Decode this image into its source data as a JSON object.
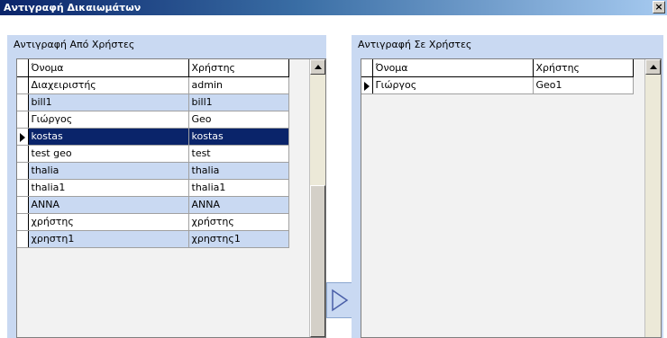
{
  "window": {
    "title": "Αντιγραφή Δικαιωμάτων",
    "close_glyph": "×"
  },
  "left_panel": {
    "header": "Αντιγραφή Από Χρήστες",
    "columns": [
      "Όνομα",
      "Χρήστης"
    ],
    "rows": [
      {
        "name": "Διαχειριστής",
        "user": "admin",
        "style": "white"
      },
      {
        "name": "bill1",
        "user": "bill1",
        "style": "blue"
      },
      {
        "name": "Γιώργος",
        "user": "Geo",
        "style": "white"
      },
      {
        "name": "kostas",
        "user": "kostas",
        "style": "selected"
      },
      {
        "name": "test geo",
        "user": "test",
        "style": "white"
      },
      {
        "name": "thalia",
        "user": "thalia",
        "style": "blue"
      },
      {
        "name": "thalia1",
        "user": "thalia1",
        "style": "white"
      },
      {
        "name": "ANNA",
        "user": "ANNA",
        "style": "blue"
      },
      {
        "name": "χρήστης",
        "user": "χρήστης",
        "style": "white"
      },
      {
        "name": "χρηστη1",
        "user": "χρηστης1",
        "style": "blue"
      }
    ]
  },
  "right_panel": {
    "header": "Αντιγραφή Σε Χρήστες",
    "columns": [
      "Όνομα",
      "Χρήστης"
    ],
    "rows": [
      {
        "name": "Γιώργος",
        "user": "Geo1",
        "style": "current"
      }
    ]
  },
  "copy_button": {
    "icon": "triangle-right-icon"
  },
  "colors": {
    "panel_bg": "#c9d9f2",
    "selection": "#0a246a",
    "titlebar_start": "#0a246a",
    "titlebar_end": "#a6caf0"
  }
}
